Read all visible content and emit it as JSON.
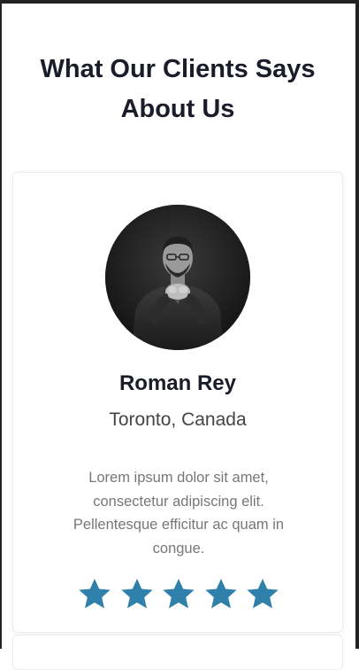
{
  "section": {
    "title": "What Our Clients Says About Us"
  },
  "testimonial": {
    "name": "Roman Rey",
    "location": "Toronto, Canada",
    "quote": "Lorem ipsum dolor sit amet, consectetur adipiscing elit. Pellentesque efficitur ac quam in congue.",
    "rating": 5,
    "rating_max": 5,
    "avatar_icon": "person-photo",
    "star_icon": "star-icon"
  },
  "colors": {
    "heading": "#1a1d29",
    "star": "#2f80aa",
    "body_text": "#777777",
    "location_text": "#444444"
  }
}
